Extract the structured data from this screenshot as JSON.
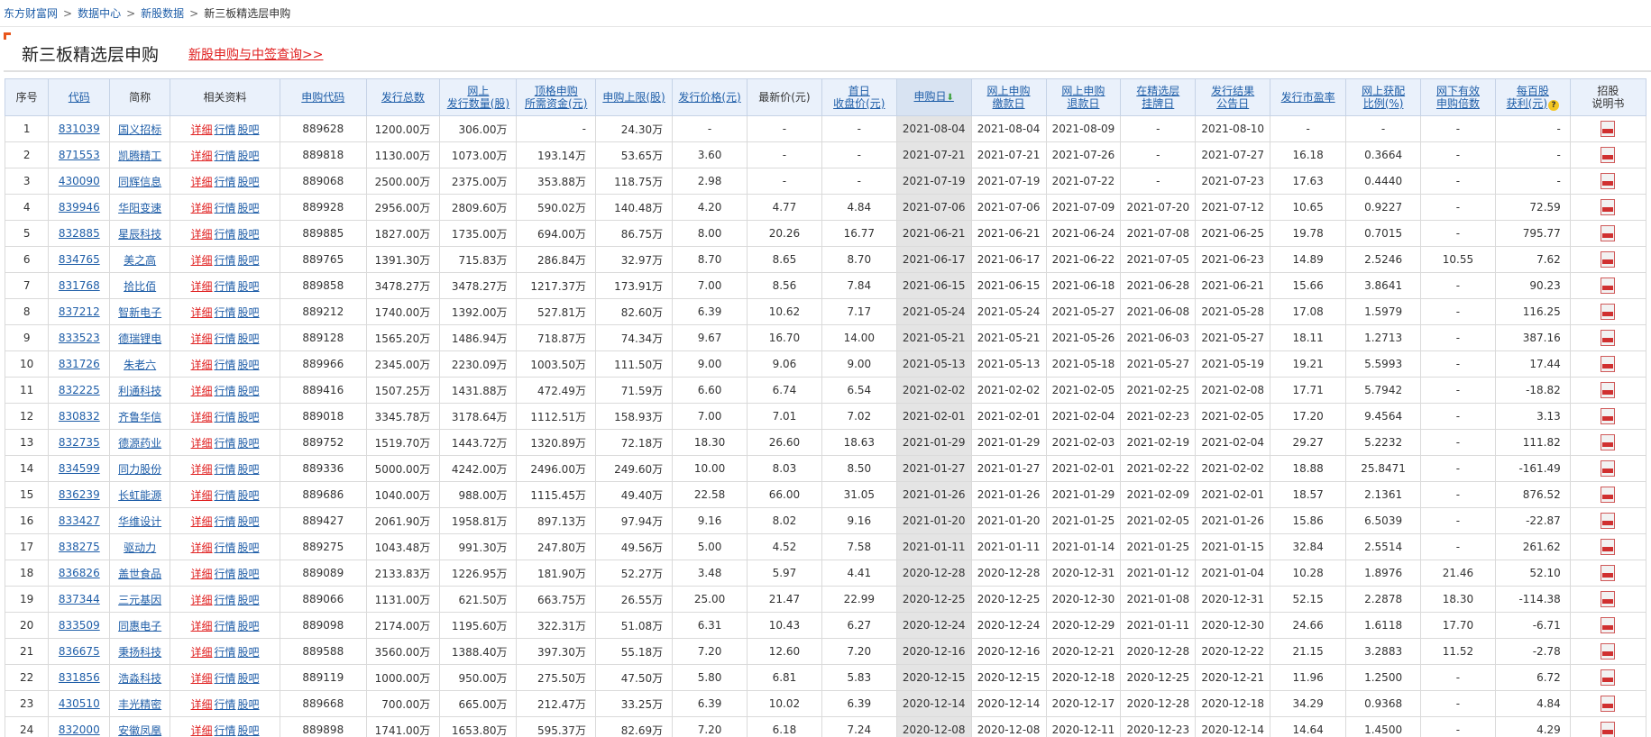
{
  "breadcrumb": [
    "东方财富网",
    "数据中心",
    "新股数据",
    "新三板精选层申购"
  ],
  "title": "新三板精选层申购",
  "title_link": "新股申购与中签查询>>",
  "headers": {
    "seq": "序号",
    "code": "代码",
    "name": "简称",
    "related": "相关资料",
    "sub_code": "申购代码",
    "total": "发行总数",
    "online_qty_1": "网上",
    "online_qty_2": "发行数量(股)",
    "fund_1": "顶格申购",
    "fund_2": "所需资金(元)",
    "limit": "申购上限(股)",
    "price": "发行价格(元)",
    "latest": "最新价(元)",
    "first_1": "首日",
    "first_2": "收盘价(元)",
    "date": "申购日",
    "pay_1": "网上申购",
    "pay_2": "缴款日",
    "refund_1": "网上申购",
    "refund_2": "退款日",
    "list_1": "在精选层",
    "list_2": "挂牌日",
    "result_1": "发行结果",
    "result_2": "公告日",
    "pe": "发行市盈率",
    "ratio_1": "网上获配",
    "ratio_2": "比例(%)",
    "offline_1": "网下有效",
    "offline_2": "申购倍数",
    "profit_1": "每百股",
    "profit_2": "获利(元)",
    "prospectus_1": "招股",
    "prospectus_2": "说明书",
    "help_icon": "?",
    "sort_arrow": "⬇"
  },
  "row_links": [
    "详细",
    "行情",
    "股吧"
  ],
  "rows": [
    [
      "1",
      "831039",
      "国义招标",
      "889628",
      "1200.00万",
      "306.00万",
      "-",
      "24.30万",
      "-",
      "-",
      "-",
      "2021-08-04",
      "2021-08-04",
      "2021-08-09",
      "-",
      "2021-08-10",
      "-",
      "-",
      "-",
      "-"
    ],
    [
      "2",
      "871553",
      "凯腾精工",
      "889818",
      "1130.00万",
      "1073.00万",
      "193.14万",
      "53.65万",
      "3.60",
      "-",
      "-",
      "2021-07-21",
      "2021-07-21",
      "2021-07-26",
      "-",
      "2021-07-27",
      "16.18",
      "0.3664",
      "-",
      "-"
    ],
    [
      "3",
      "430090",
      "同辉信息",
      "889068",
      "2500.00万",
      "2375.00万",
      "353.88万",
      "118.75万",
      "2.98",
      "-",
      "-",
      "2021-07-19",
      "2021-07-19",
      "2021-07-22",
      "-",
      "2021-07-23",
      "17.63",
      "0.4440",
      "-",
      "-"
    ],
    [
      "4",
      "839946",
      "华阳变速",
      "889928",
      "2956.00万",
      "2809.60万",
      "590.02万",
      "140.48万",
      "4.20",
      "4.77",
      "4.84",
      "2021-07-06",
      "2021-07-06",
      "2021-07-09",
      "2021-07-20",
      "2021-07-12",
      "10.65",
      "0.9227",
      "-",
      "72.59"
    ],
    [
      "5",
      "832885",
      "星辰科技",
      "889885",
      "1827.00万",
      "1735.00万",
      "694.00万",
      "86.75万",
      "8.00",
      "20.26",
      "16.77",
      "2021-06-21",
      "2021-06-21",
      "2021-06-24",
      "2021-07-08",
      "2021-06-25",
      "19.78",
      "0.7015",
      "-",
      "795.77"
    ],
    [
      "6",
      "834765",
      "美之高",
      "889765",
      "1391.30万",
      "715.83万",
      "286.84万",
      "32.97万",
      "8.70",
      "8.65",
      "8.70",
      "2021-06-17",
      "2021-06-17",
      "2021-06-22",
      "2021-07-05",
      "2021-06-23",
      "14.89",
      "2.5246",
      "10.55",
      "7.62"
    ],
    [
      "7",
      "831768",
      "拾比佰",
      "889858",
      "3478.27万",
      "3478.27万",
      "1217.37万",
      "173.91万",
      "7.00",
      "8.56",
      "7.84",
      "2021-06-15",
      "2021-06-15",
      "2021-06-18",
      "2021-06-28",
      "2021-06-21",
      "15.66",
      "3.8641",
      "-",
      "90.23"
    ],
    [
      "8",
      "837212",
      "智新电子",
      "889212",
      "1740.00万",
      "1392.00万",
      "527.81万",
      "82.60万",
      "6.39",
      "10.62",
      "7.17",
      "2021-05-24",
      "2021-05-24",
      "2021-05-27",
      "2021-06-08",
      "2021-05-28",
      "17.08",
      "1.5979",
      "-",
      "116.25"
    ],
    [
      "9",
      "833523",
      "德瑞锂电",
      "889128",
      "1565.20万",
      "1486.94万",
      "718.87万",
      "74.34万",
      "9.67",
      "16.70",
      "14.00",
      "2021-05-21",
      "2021-05-21",
      "2021-05-26",
      "2021-06-03",
      "2021-05-27",
      "18.11",
      "1.2713",
      "-",
      "387.16"
    ],
    [
      "10",
      "831726",
      "朱老六",
      "889966",
      "2345.00万",
      "2230.09万",
      "1003.50万",
      "111.50万",
      "9.00",
      "9.06",
      "9.00",
      "2021-05-13",
      "2021-05-13",
      "2021-05-18",
      "2021-05-27",
      "2021-05-19",
      "19.21",
      "5.5993",
      "-",
      "17.44"
    ],
    [
      "11",
      "832225",
      "利通科技",
      "889416",
      "1507.25万",
      "1431.88万",
      "472.49万",
      "71.59万",
      "6.60",
      "6.74",
      "6.54",
      "2021-02-02",
      "2021-02-02",
      "2021-02-05",
      "2021-02-25",
      "2021-02-08",
      "17.71",
      "5.7942",
      "-",
      "-18.82"
    ],
    [
      "12",
      "830832",
      "齐鲁华信",
      "889018",
      "3345.78万",
      "3178.64万",
      "1112.51万",
      "158.93万",
      "7.00",
      "7.01",
      "7.02",
      "2021-02-01",
      "2021-02-01",
      "2021-02-04",
      "2021-02-23",
      "2021-02-05",
      "17.20",
      "9.4564",
      "-",
      "3.13"
    ],
    [
      "13",
      "832735",
      "德源药业",
      "889752",
      "1519.70万",
      "1443.72万",
      "1320.89万",
      "72.18万",
      "18.30",
      "26.60",
      "18.63",
      "2021-01-29",
      "2021-01-29",
      "2021-02-03",
      "2021-02-19",
      "2021-02-04",
      "29.27",
      "5.2232",
      "-",
      "111.82"
    ],
    [
      "14",
      "834599",
      "同力股份",
      "889336",
      "5000.00万",
      "4242.00万",
      "2496.00万",
      "249.60万",
      "10.00",
      "8.03",
      "8.50",
      "2021-01-27",
      "2021-01-27",
      "2021-02-01",
      "2021-02-22",
      "2021-02-02",
      "18.88",
      "25.8471",
      "-",
      "-161.49"
    ],
    [
      "15",
      "836239",
      "长虹能源",
      "889686",
      "1040.00万",
      "988.00万",
      "1115.45万",
      "49.40万",
      "22.58",
      "66.00",
      "31.05",
      "2021-01-26",
      "2021-01-26",
      "2021-01-29",
      "2021-02-09",
      "2021-02-01",
      "18.57",
      "2.1361",
      "-",
      "876.52"
    ],
    [
      "16",
      "833427",
      "华维设计",
      "889427",
      "2061.90万",
      "1958.81万",
      "897.13万",
      "97.94万",
      "9.16",
      "8.02",
      "9.16",
      "2021-01-20",
      "2021-01-20",
      "2021-01-25",
      "2021-02-05",
      "2021-01-26",
      "15.86",
      "6.5039",
      "-",
      "-22.87"
    ],
    [
      "17",
      "838275",
      "驱动力",
      "889275",
      "1043.48万",
      "991.30万",
      "247.80万",
      "49.56万",
      "5.00",
      "4.52",
      "7.58",
      "2021-01-11",
      "2021-01-11",
      "2021-01-14",
      "2021-01-25",
      "2021-01-15",
      "32.84",
      "2.5514",
      "-",
      "261.62"
    ],
    [
      "18",
      "836826",
      "盖世食品",
      "889089",
      "2133.83万",
      "1226.95万",
      "181.90万",
      "52.27万",
      "3.48",
      "5.97",
      "4.41",
      "2020-12-28",
      "2020-12-28",
      "2020-12-31",
      "2021-01-12",
      "2021-01-04",
      "10.28",
      "1.8976",
      "21.46",
      "52.10"
    ],
    [
      "19",
      "837344",
      "三元基因",
      "889066",
      "1131.00万",
      "621.50万",
      "663.75万",
      "26.55万",
      "25.00",
      "21.47",
      "22.99",
      "2020-12-25",
      "2020-12-25",
      "2020-12-30",
      "2021-01-08",
      "2020-12-31",
      "52.15",
      "2.2878",
      "18.30",
      "-114.38"
    ],
    [
      "20",
      "833509",
      "同惠电子",
      "889098",
      "2174.00万",
      "1195.60万",
      "322.31万",
      "51.08万",
      "6.31",
      "10.43",
      "6.27",
      "2020-12-24",
      "2020-12-24",
      "2020-12-29",
      "2021-01-11",
      "2020-12-30",
      "24.66",
      "1.6118",
      "17.70",
      "-6.71"
    ],
    [
      "21",
      "836675",
      "秉扬科技",
      "889588",
      "3560.00万",
      "1388.40万",
      "397.30万",
      "55.18万",
      "7.20",
      "12.60",
      "7.20",
      "2020-12-16",
      "2020-12-16",
      "2020-12-21",
      "2020-12-28",
      "2020-12-22",
      "21.15",
      "3.2883",
      "11.52",
      "-2.78"
    ],
    [
      "22",
      "831856",
      "浩淼科技",
      "889119",
      "1000.00万",
      "950.00万",
      "275.50万",
      "47.50万",
      "5.80",
      "6.81",
      "5.83",
      "2020-12-15",
      "2020-12-15",
      "2020-12-18",
      "2020-12-25",
      "2020-12-21",
      "11.96",
      "1.2500",
      "-",
      "6.72"
    ],
    [
      "23",
      "430510",
      "丰光精密",
      "889668",
      "700.00万",
      "665.00万",
      "212.47万",
      "33.25万",
      "6.39",
      "10.02",
      "6.39",
      "2020-12-14",
      "2020-12-14",
      "2020-12-17",
      "2020-12-28",
      "2020-12-18",
      "34.29",
      "0.9368",
      "-",
      "4.84"
    ],
    [
      "24",
      "832000",
      "安徽凤凰",
      "889898",
      "1741.00万",
      "1653.80万",
      "595.37万",
      "82.69万",
      "7.20",
      "6.18",
      "7.24",
      "2020-12-08",
      "2020-12-08",
      "2020-12-11",
      "2020-12-23",
      "2020-12-14",
      "14.64",
      "1.4500",
      "-",
      "4.29"
    ]
  ]
}
